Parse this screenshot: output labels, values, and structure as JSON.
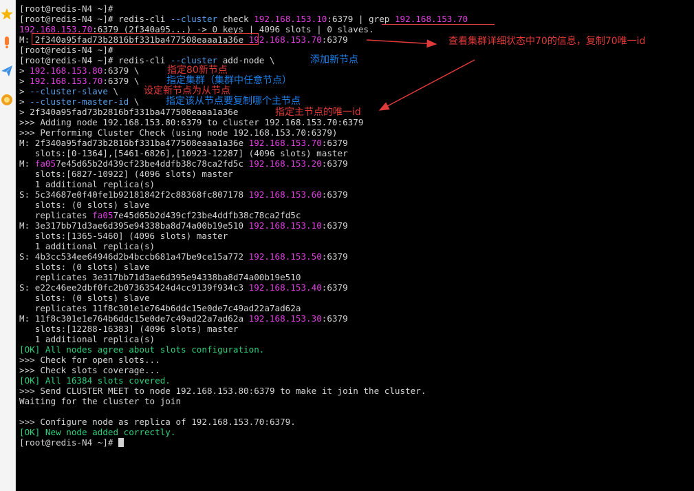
{
  "colors": {
    "background": "#000000",
    "text": "#d3d3d3",
    "ip": "#e040e0",
    "ok": "#2fcf7a",
    "option": "#5aa0e8",
    "annotation_red": "#e03a3a",
    "annotation_blue": "#1e7ee6"
  },
  "sidebar": {
    "icons": [
      "star-icon",
      "bookmark-icon",
      "paper-plane-icon",
      "badge-icon"
    ]
  },
  "terminal": {
    "lines": [
      [
        {
          "t": "[root@redis-N4 ~]#"
        }
      ],
      [
        {
          "t": "[root@redis-N4 ~]# redis-cli "
        },
        {
          "t": "--cluster",
          "c": "option"
        },
        {
          "t": " check "
        },
        {
          "t": "192.168.153.10",
          "c": "ip"
        },
        {
          "t": ":6379 | grep "
        },
        {
          "t": "192.168.153.70",
          "c": "ip"
        }
      ],
      [
        {
          "t": "192.168.153.70",
          "c": "ip"
        },
        {
          "t": ":6379 (2f340a95...) -> 0 keys | 4096 slots | 0 slaves."
        }
      ],
      [
        {
          "t": "M: 2f340a95fad73b2816bf331ba477508eaaa1a36e "
        },
        {
          "t": "192.168.153.70",
          "c": "ip"
        },
        {
          "t": ":6379"
        }
      ],
      [
        {
          "t": "[root@redis-N4 ~]#"
        }
      ],
      [
        {
          "t": "[root@redis-N4 ~]# redis-cli "
        },
        {
          "t": "--cluster",
          "c": "option"
        },
        {
          "t": " add-node \\"
        }
      ],
      [
        {
          "t": "> "
        },
        {
          "t": "192.168.153.80",
          "c": "ip"
        },
        {
          "t": ":6379 \\"
        }
      ],
      [
        {
          "t": "> "
        },
        {
          "t": "192.168.153.70",
          "c": "ip"
        },
        {
          "t": ":6379 \\"
        }
      ],
      [
        {
          "t": "> "
        },
        {
          "t": "--cluster-slave",
          "c": "option"
        },
        {
          "t": " \\"
        }
      ],
      [
        {
          "t": "> "
        },
        {
          "t": "--cluster-master-id",
          "c": "option"
        },
        {
          "t": " \\"
        }
      ],
      [
        {
          "t": "> 2f340a95fad73b2816bf331ba477508eaaa1a36e"
        }
      ],
      [
        {
          "t": ">>> Adding node 192.168.153.80:6379 to cluster 192.168.153.70:6379"
        }
      ],
      [
        {
          "t": ">>> Performing Cluster Check (using node 192.168.153.70:6379)"
        }
      ],
      [
        {
          "t": "M: 2f340a95fad73b2816bf331ba477508eaaa1a36e "
        },
        {
          "t": "192.168.153.70",
          "c": "ip"
        },
        {
          "t": ":6379"
        }
      ],
      [
        {
          "t": "   slots:[0-1364],[5461-6826],[10923-12287] (4096 slots) master"
        }
      ],
      [
        {
          "t": "M: "
        },
        {
          "t": "fa05",
          "c": "ip"
        },
        {
          "t": "7e45d65b2d439cf23be4ddfb38c78ca2fd5c "
        },
        {
          "t": "192.168.153.20",
          "c": "ip"
        },
        {
          "t": ":6379"
        }
      ],
      [
        {
          "t": "   slots:[6827-10922] (4096 slots) master"
        }
      ],
      [
        {
          "t": "   1 additional replica(s)"
        }
      ],
      [
        {
          "t": "S: 5c34687e0f40fe1b92181842f2c88368fc807178 "
        },
        {
          "t": "192.168.153.60",
          "c": "ip"
        },
        {
          "t": ":6379"
        }
      ],
      [
        {
          "t": "   slots: (0 slots) slave"
        }
      ],
      [
        {
          "t": "   replicates "
        },
        {
          "t": "fa05",
          "c": "ip"
        },
        {
          "t": "7e45d65b2d439cf23be4ddfb38c78ca2fd5c"
        }
      ],
      [
        {
          "t": "M: 3e317bb71d3ae6d395e94338ba8d74a00b19e510 "
        },
        {
          "t": "192.168.153.10",
          "c": "ip"
        },
        {
          "t": ":6379"
        }
      ],
      [
        {
          "t": "   slots:[1365-5460] (4096 slots) master"
        }
      ],
      [
        {
          "t": "   1 additional replica(s)"
        }
      ],
      [
        {
          "t": "S: 4b3cc534ee64946d2b4bccb681a47be9ce15a772 "
        },
        {
          "t": "192.168.153.50",
          "c": "ip"
        },
        {
          "t": ":6379"
        }
      ],
      [
        {
          "t": "   slots: (0 slots) slave"
        }
      ],
      [
        {
          "t": "   replicates 3e317bb71d3ae6d395e94338ba8d74a00b19e510"
        }
      ],
      [
        {
          "t": "S: e22c46ee2dbf0fc2b073635424d4cc9139f934c3 "
        },
        {
          "t": "192.168.153.40",
          "c": "ip"
        },
        {
          "t": ":6379"
        }
      ],
      [
        {
          "t": "   slots: (0 slots) slave"
        }
      ],
      [
        {
          "t": "   replicates 11f8c301e1e764b6ddc15e0de7c49ad22a7ad62a"
        }
      ],
      [
        {
          "t": "M: 11f8c301e1e764b6ddc15e0de7c49ad22a7ad62a "
        },
        {
          "t": "192.168.153.30",
          "c": "ip"
        },
        {
          "t": ":6379"
        }
      ],
      [
        {
          "t": "   slots:[12288-16383] (4096 slots) master"
        }
      ],
      [
        {
          "t": "   1 additional replica(s)"
        }
      ],
      [
        {
          "t": "[OK] All nodes agree about slots configuration.",
          "c": "ok"
        }
      ],
      [
        {
          "t": ">>> Check for open slots..."
        }
      ],
      [
        {
          "t": ">>> Check slots coverage..."
        }
      ],
      [
        {
          "t": "[OK] All 16384 slots covered.",
          "c": "ok"
        }
      ],
      [
        {
          "t": ">>> Send CLUSTER MEET to node 192.168.153.80:6379 to make it join the cluster."
        }
      ],
      [
        {
          "t": "Waiting for the cluster to join"
        }
      ],
      [
        {
          "t": ""
        }
      ],
      [
        {
          "t": ">>> Configure node as replica of 192.168.153.70:6379."
        }
      ],
      [
        {
          "t": "[OK] New node added correctly.",
          "c": "ok"
        }
      ],
      [
        {
          "t": "[root@redis-N4 ~]# "
        },
        {
          "t": "",
          "cursor": true
        }
      ]
    ]
  },
  "annotations": {
    "copy_id": "查看集群详细状态中70的信息，复制70唯一id",
    "add_node": "添加新节点",
    "new_node": "指定80新节点",
    "any_node": "指定集群（集群中任意节点）",
    "as_slave": "设定新节点为从节点",
    "which_master": "指定该从节点要复制哪个主节点",
    "master_id": "指定主节点的唯一id"
  }
}
